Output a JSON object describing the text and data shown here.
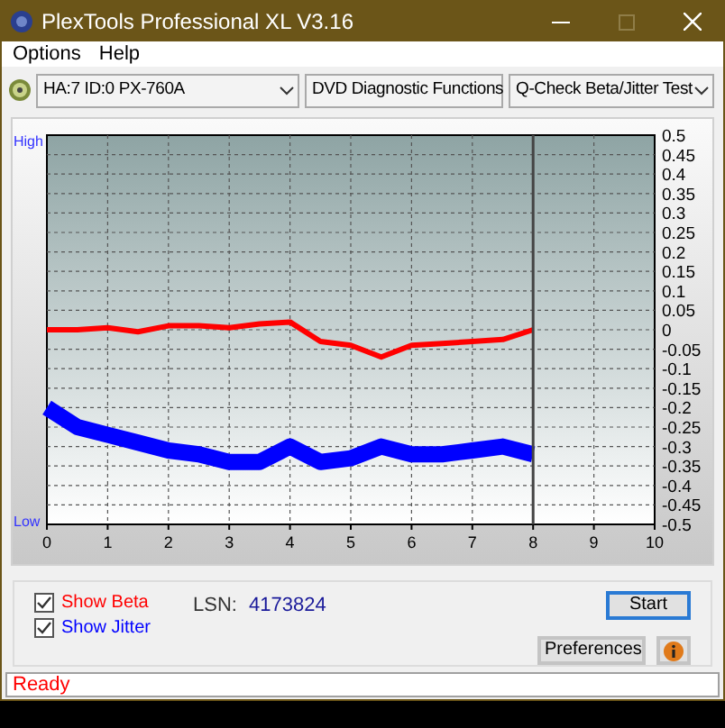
{
  "window": {
    "title": "PlexTools Professional XL V3.16"
  },
  "menu": [
    {
      "label": "Options"
    },
    {
      "label": "Help"
    }
  ],
  "toolbar": [
    {
      "value": "HA:7 ID:0  PX-760A"
    },
    {
      "value": "DVD Diagnostic Functions"
    },
    {
      "value": "Q-Check Beta/Jitter Test"
    }
  ],
  "chart": {
    "high_label": "High",
    "low_label": "Low",
    "chart_data": {
      "type": "line",
      "x": [
        0,
        0.5,
        1,
        1.5,
        2,
        2.5,
        3,
        3.5,
        4,
        4.5,
        5,
        5.5,
        6,
        6.5,
        7,
        7.5,
        8
      ],
      "series": [
        {
          "color": "#ff0000",
          "values": [
            0,
            0,
            0.005,
            -0.005,
            0.01,
            0.01,
            0.005,
            0.015,
            0.02,
            -0.03,
            -0.04,
            -0.07,
            -0.04,
            -0.035,
            -0.03,
            -0.025,
            0
          ]
        },
        {
          "color": "#0000ff",
          "values": [
            -0.2,
            -0.25,
            -0.27,
            -0.29,
            -0.31,
            -0.32,
            -0.34,
            -0.34,
            -0.3,
            -0.34,
            -0.33,
            -0.3,
            -0.32,
            -0.32,
            -0.31,
            -0.3,
            -0.32
          ]
        }
      ],
      "xlim": [
        0,
        10
      ],
      "ylim": [
        -0.5,
        0.5
      ],
      "xticks": [
        0,
        1,
        2,
        3,
        4,
        5,
        6,
        7,
        8,
        9,
        10
      ],
      "yticks": [
        0.5,
        0.45,
        0.4,
        0.35,
        0.3,
        0.25,
        0.2,
        0.15,
        0.1,
        0.05,
        0,
        -0.05,
        -0.1,
        -0.15,
        -0.2,
        -0.25,
        -0.3,
        -0.35,
        -0.4,
        -0.45,
        -0.5
      ],
      "grid": true,
      "ref_lines": [
        {
          "axis": "x",
          "value": 8
        }
      ]
    }
  },
  "checkboxes": [
    {
      "label": "Show Beta",
      "checked": true,
      "color": "#ff0000"
    },
    {
      "label": "Show Jitter",
      "checked": true,
      "color": "#0000ff"
    }
  ],
  "lsn": {
    "label": "LSN:",
    "value": "4173824"
  },
  "buttons": [
    {
      "kind": "text",
      "label": "Start",
      "default": true
    },
    {
      "kind": "text",
      "label": "Preferences",
      "default": false
    },
    {
      "kind": "info",
      "default": false
    }
  ],
  "status": "Ready"
}
